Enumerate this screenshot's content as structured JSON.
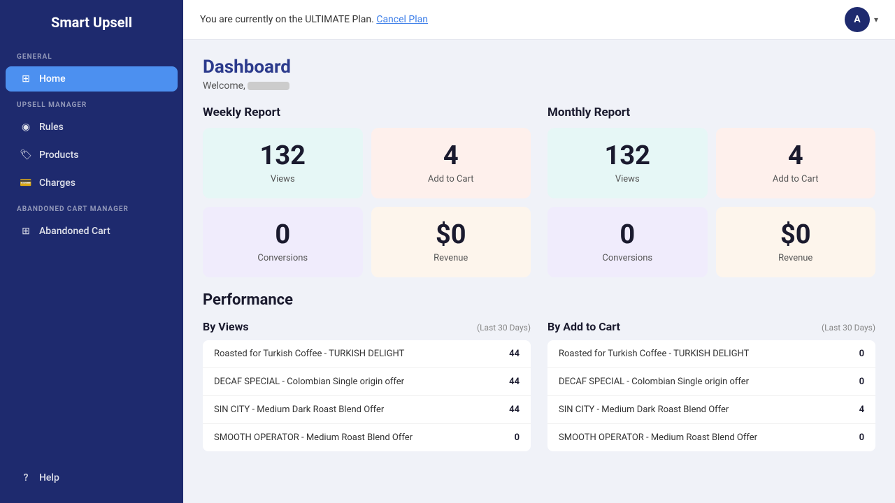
{
  "app": {
    "title": "Smart Upsell"
  },
  "banner": {
    "text": "You are currently on the ULTIMATE Plan.",
    "cancel_link": "Cancel Plan"
  },
  "avatar": {
    "letter": "A"
  },
  "sidebar": {
    "general_label": "GENERAL",
    "upsell_label": "UPSELL MANAGER",
    "abandoned_label": "ABANDONED CART MANAGER",
    "items": [
      {
        "id": "home",
        "label": "Home",
        "icon": "⊞",
        "active": true
      },
      {
        "id": "rules",
        "label": "Rules",
        "icon": "◉",
        "active": false
      },
      {
        "id": "products",
        "label": "Products",
        "icon": "🏷",
        "active": false
      },
      {
        "id": "charges",
        "label": "Charges",
        "icon": "💳",
        "active": false
      },
      {
        "id": "abandoned-cart",
        "label": "Abandoned Cart",
        "icon": "⊞",
        "active": false
      }
    ],
    "help_label": "Help"
  },
  "dashboard": {
    "title": "Dashboard",
    "welcome_prefix": "Welcome, "
  },
  "weekly_report": {
    "title": "Weekly Report",
    "cards": [
      {
        "value": "132",
        "label": "Views",
        "color": "teal"
      },
      {
        "value": "4",
        "label": "Add to Cart",
        "color": "peach"
      },
      {
        "value": "0",
        "label": "Conversions",
        "color": "lavender"
      },
      {
        "value": "$0",
        "label": "Revenue",
        "color": "cream"
      }
    ]
  },
  "monthly_report": {
    "title": "Monthly Report",
    "cards": [
      {
        "value": "132",
        "label": "Views",
        "color": "teal"
      },
      {
        "value": "4",
        "label": "Add to Cart",
        "color": "peach"
      },
      {
        "value": "0",
        "label": "Conversions",
        "color": "lavender"
      },
      {
        "value": "$0",
        "label": "Revenue",
        "color": "cream"
      }
    ]
  },
  "performance": {
    "title": "Performance",
    "by_views": {
      "title": "By Views",
      "subtitle": "(Last 30 Days)",
      "rows": [
        {
          "name": "Roasted for Turkish Coffee - TURKISH DELIGHT",
          "value": "44"
        },
        {
          "name": "DECAF SPECIAL - Colombian Single origin offer",
          "value": "44"
        },
        {
          "name": "SIN CITY - Medium Dark Roast Blend Offer",
          "value": "44"
        },
        {
          "name": "SMOOTH OPERATOR - Medium Roast Blend Offer",
          "value": "0"
        }
      ]
    },
    "by_add_to_cart": {
      "title": "By Add to Cart",
      "subtitle": "(Last 30 Days)",
      "rows": [
        {
          "name": "Roasted for Turkish Coffee - TURKISH DELIGHT",
          "value": "0"
        },
        {
          "name": "DECAF SPECIAL - Colombian Single origin offer",
          "value": "0"
        },
        {
          "name": "SIN CITY - Medium Dark Roast Blend Offer",
          "value": "4"
        },
        {
          "name": "SMOOTH OPERATOR - Medium Roast Blend Offer",
          "value": "0"
        }
      ]
    }
  }
}
